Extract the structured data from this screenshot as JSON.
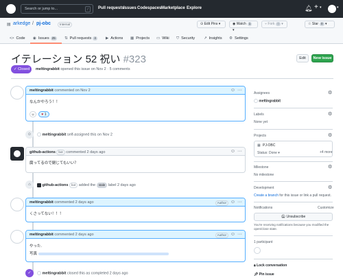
{
  "nav": {
    "search_placeholder": "Search or jump to...",
    "slash": "/",
    "links": [
      "Pull requests",
      "Issues",
      "Codespaces",
      "Marketplace",
      "Explore"
    ]
  },
  "repo": {
    "owner": "arkedge",
    "name": "pj-obc",
    "visibility": "Internal",
    "edit_pins": "Edit Pins",
    "watch": "Watch",
    "watch_count": "1",
    "fork": "Fork",
    "fork_count": "0",
    "star": "Star",
    "star_count": "0"
  },
  "tabs": [
    {
      "label": "Code",
      "icon": "<>"
    },
    {
      "label": "Issues",
      "icon": "◉",
      "count": "25"
    },
    {
      "label": "Pull requests",
      "icon": "⇅",
      "count": "4"
    },
    {
      "label": "Actions",
      "icon": "▶"
    },
    {
      "label": "Projects",
      "icon": "▦"
    },
    {
      "label": "Wiki",
      "icon": "▭"
    },
    {
      "label": "Security",
      "icon": "⛉"
    },
    {
      "label": "Insights",
      "icon": "↗"
    },
    {
      "label": "Settings",
      "icon": "⚙"
    }
  ],
  "issue": {
    "title": "イテレーション 52 祝い",
    "number": "#323",
    "state": "Closed",
    "author": "meltingrabbit",
    "meta": "opened this issue on Nov 2 · 5 comments",
    "edit": "Edit",
    "new_issue": "New issue"
  },
  "timeline": {
    "c1": {
      "author": "meltingrabbit",
      "meta": "commented on Nov 2",
      "body": "なんかやろう！！",
      "reaction_count": "1"
    },
    "e1": {
      "author": "meltingrabbit",
      "text": "self-assigned this on Nov 2"
    },
    "c2": {
      "author": "github-actions",
      "badge": "bot",
      "meta": "commented 2 days ago",
      "body": "腐ってるので閉じてもいい？"
    },
    "e2": {
      "author": "github-actions",
      "badge": "bot",
      "text1": "added the",
      "label": "stale",
      "text2": "label 2 days ago"
    },
    "c3": {
      "author": "meltingrabbit",
      "meta": "commented 2 days ago",
      "role": "Author",
      "body": "くさってない！！！"
    },
    "c4": {
      "author": "meltingrabbit",
      "meta": "commented 2 days ago",
      "role": "Author",
      "body1": "やった.",
      "body2": "写真"
    },
    "e3": {
      "author": "meltingrabbit",
      "text": "closed this as completed 2 days ago"
    }
  },
  "sidebar": {
    "assignees_h": "Assignees",
    "assignee": "meltingrabbit",
    "labels_h": "Labels",
    "labels_val": "None yet",
    "projects_h": "Projects",
    "project": "PJ-OBC",
    "status": "Status: Done",
    "more": "+4 more",
    "milestone_h": "Milestone",
    "milestone_val": "No milestone",
    "dev_h": "Development",
    "dev_link": "Create a branch",
    "dev_rest": "for this issue or link a pull request.",
    "notif_h": "Notifications",
    "customize": "Customize",
    "unsubscribe": "Unsubscribe",
    "notif_text": "You're receiving notifications because you modified the open/close state.",
    "participants": "1 participant",
    "lock": "Lock conversation",
    "pin": "Pin issue"
  }
}
